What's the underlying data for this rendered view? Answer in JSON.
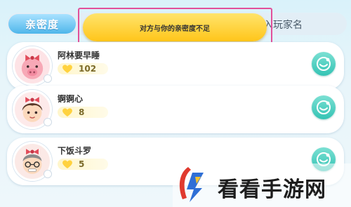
{
  "header": {
    "tab_label": "亲密度",
    "search_text": "入玩家名"
  },
  "toast": {
    "message": "对方与你的亲密度不足"
  },
  "friends": [
    {
      "name": "阿林要早睡",
      "intimacy": "102"
    },
    {
      "name": "锕锕心",
      "intimacy": "8"
    },
    {
      "name": "下饭斗罗",
      "intimacy": "5"
    }
  ],
  "watermark": {
    "text": "看看手游网"
  },
  "colors": {
    "highlight": "#e2509a",
    "tab_blue": "#4fb6ea",
    "toast_yellow": "#ffc51a",
    "action_teal": "#34c3b4"
  }
}
